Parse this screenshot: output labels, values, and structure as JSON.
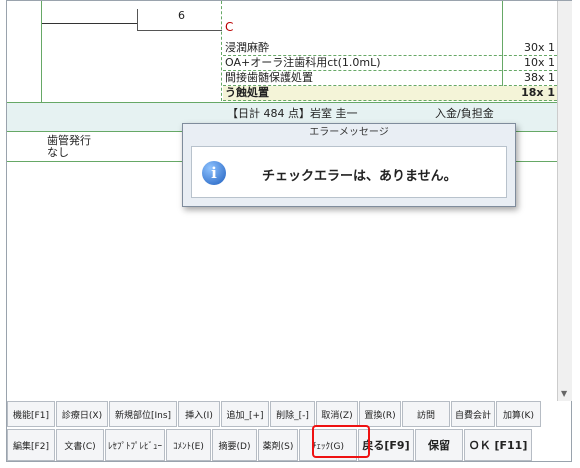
{
  "record": {
    "tooth_number": "6",
    "proc_code": "C",
    "procedures": [
      {
        "name": "浸潤麻酔",
        "amount": "30x 1",
        "bold": false
      },
      {
        "name": "OA+オーラ注歯科用ct(1.0mL)",
        "amount": "10x 1",
        "bold": false
      },
      {
        "name": "間接歯髄保護処置",
        "amount": "38x 1",
        "bold": false
      },
      {
        "name": "う蝕処置",
        "amount": "18x 1",
        "bold": true
      }
    ],
    "total_text": "【日計 484 点】岩室 圭一",
    "total_right": "入金/負担金",
    "issue_label": "歯管発行",
    "issue_value": "なし"
  },
  "dialog": {
    "title": "エラーメッセージ",
    "message": "チェックエラーは、ありません。",
    "icon": "info-icon"
  },
  "toolbar_row1": [
    {
      "label": "機能[F1]",
      "w": 48
    },
    {
      "label": "診療日(X)",
      "w": 52
    },
    {
      "label": "新規部位[Ins]",
      "w": 68
    },
    {
      "label": "挿入(I)",
      "w": 42
    },
    {
      "label": "追加_[+]",
      "w": 48
    },
    {
      "label": "削除_[-]",
      "w": 45
    },
    {
      "label": "取消(Z)",
      "w": 42
    },
    {
      "label": "置換(R)",
      "w": 42
    },
    {
      "label": "訪問",
      "w": 48
    },
    {
      "label": "自費会計",
      "w": 44
    },
    {
      "label": "加算(K)",
      "w": 45
    }
  ],
  "toolbar_row2": [
    {
      "label": "編集[F2]",
      "w": 48,
      "big": false
    },
    {
      "label": "文書(C)",
      "w": 48,
      "big": false
    },
    {
      "label": "ﾚｾﾌﾟﾄﾌﾟﾚﾋﾞｭｰ",
      "w": 60,
      "big": false
    },
    {
      "label": "ｺﾒﾝﾄ(E)",
      "w": 45,
      "big": false
    },
    {
      "label": "摘要(D)",
      "w": 45,
      "big": false
    },
    {
      "label": "薬剤(S)",
      "w": 40,
      "big": false
    },
    {
      "label": "ﾁｪｯｸ(G)",
      "w": 58,
      "big": false
    },
    {
      "label": "戻る[F9]",
      "w": 56,
      "big": true
    },
    {
      "label": "保留",
      "w": 48,
      "big": true
    },
    {
      "label": "ＯＫ [F11]",
      "w": 68,
      "big": true
    }
  ]
}
